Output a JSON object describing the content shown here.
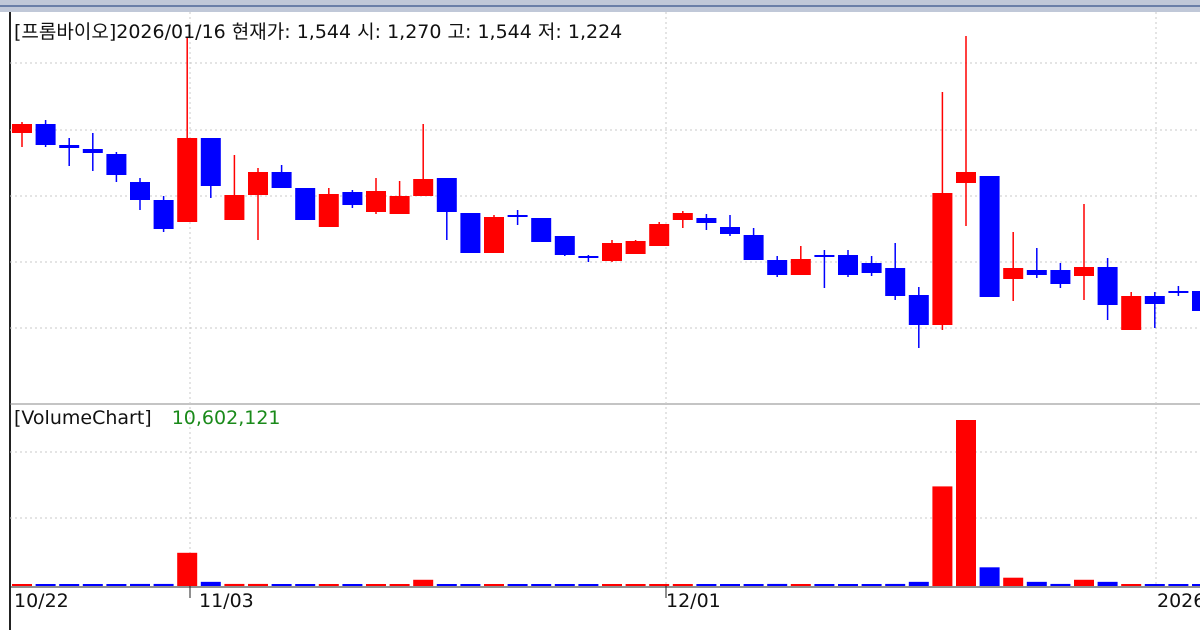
{
  "price_header": {
    "stock_name": "[프롬바이오]",
    "date": "2026/01/16",
    "current_label": "현재가:",
    "current": "1,544",
    "open_label": "시:",
    "open": "1,270",
    "high_label": "고:",
    "high": "1,544",
    "low_label": "저:",
    "low": "1,224"
  },
  "volume_header": {
    "label": "[VolumeChart]",
    "value": "10,602,121"
  },
  "colors": {
    "up": "#ff0000",
    "down": "#0000ff",
    "grid": "#c8c8c8",
    "axis": "#222222",
    "volume_value": "#1a8a1a"
  },
  "chart_data": [
    {
      "type": "candlestick",
      "x_tick_labels": [
        "10/22",
        "11/03",
        "12/01",
        "2026"
      ],
      "y_axis_labels_visible": false,
      "ylim": [
        38,
        412
      ],
      "grid": true,
      "candles": [
        {
          "o": 133,
          "c": 124,
          "h": 122,
          "l": 147,
          "dir": "up"
        },
        {
          "o": 124,
          "c": 145,
          "h": 120,
          "l": 147,
          "dir": "down"
        },
        {
          "o": 145,
          "c": 148,
          "h": 138,
          "l": 166,
          "dir": "down"
        },
        {
          "o": 149,
          "c": 153,
          "h": 133,
          "l": 171,
          "dir": "down"
        },
        {
          "o": 154,
          "c": 175,
          "h": 152,
          "l": 182,
          "dir": "down"
        },
        {
          "o": 182,
          "c": 200,
          "h": 178,
          "l": 210,
          "dir": "down"
        },
        {
          "o": 200,
          "c": 229,
          "h": 196,
          "l": 232,
          "dir": "down"
        },
        {
          "o": 222,
          "c": 138,
          "h": 38,
          "l": 222,
          "dir": "up"
        },
        {
          "o": 138,
          "c": 186,
          "h": 138,
          "l": 198,
          "dir": "down"
        },
        {
          "o": 220,
          "c": 195,
          "h": 155,
          "l": 220,
          "dir": "up"
        },
        {
          "o": 195,
          "c": 172,
          "h": 168,
          "l": 240,
          "dir": "up"
        },
        {
          "o": 172,
          "c": 188,
          "h": 165,
          "l": 188,
          "dir": "down"
        },
        {
          "o": 188,
          "c": 220,
          "h": 188,
          "l": 220,
          "dir": "down"
        },
        {
          "o": 227,
          "c": 194,
          "h": 188,
          "l": 227,
          "dir": "up"
        },
        {
          "o": 192,
          "c": 205,
          "h": 190,
          "l": 208,
          "dir": "down"
        },
        {
          "o": 212,
          "c": 191,
          "h": 178,
          "l": 214,
          "dir": "up"
        },
        {
          "o": 214,
          "c": 196,
          "h": 181,
          "l": 214,
          "dir": "up"
        },
        {
          "o": 196,
          "c": 179,
          "h": 124,
          "l": 196,
          "dir": "up"
        },
        {
          "o": 178,
          "c": 212,
          "h": 178,
          "l": 240,
          "dir": "down"
        },
        {
          "o": 213,
          "c": 253,
          "h": 213,
          "l": 253,
          "dir": "down"
        },
        {
          "o": 253,
          "c": 217,
          "h": 215,
          "l": 253,
          "dir": "up"
        },
        {
          "o": 215,
          "c": 217,
          "h": 210,
          "l": 225,
          "dir": "down"
        },
        {
          "o": 218,
          "c": 242,
          "h": 218,
          "l": 242,
          "dir": "down"
        },
        {
          "o": 236,
          "c": 255,
          "h": 236,
          "l": 256,
          "dir": "down"
        },
        {
          "o": 256,
          "c": 258,
          "h": 255,
          "l": 262,
          "dir": "down"
        },
        {
          "o": 261,
          "c": 243,
          "h": 240,
          "l": 262,
          "dir": "up"
        },
        {
          "o": 254,
          "c": 241,
          "h": 240,
          "l": 254,
          "dir": "up"
        },
        {
          "o": 246,
          "c": 224,
          "h": 222,
          "l": 246,
          "dir": "up"
        },
        {
          "o": 220,
          "c": 213,
          "h": 211,
          "l": 228,
          "dir": "up"
        },
        {
          "o": 218,
          "c": 223,
          "h": 214,
          "l": 230,
          "dir": "down"
        },
        {
          "o": 227,
          "c": 234,
          "h": 215,
          "l": 236,
          "dir": "down"
        },
        {
          "o": 235,
          "c": 260,
          "h": 228,
          "l": 260,
          "dir": "down"
        },
        {
          "o": 260,
          "c": 275,
          "h": 256,
          "l": 277,
          "dir": "down"
        },
        {
          "o": 275,
          "c": 259,
          "h": 246,
          "l": 275,
          "dir": "up"
        },
        {
          "o": 255,
          "c": 257,
          "h": 250,
          "l": 288,
          "dir": "down"
        },
        {
          "o": 255,
          "c": 275,
          "h": 250,
          "l": 277,
          "dir": "down"
        },
        {
          "o": 263,
          "c": 273,
          "h": 256,
          "l": 276,
          "dir": "down"
        },
        {
          "o": 268,
          "c": 296,
          "h": 243,
          "l": 300,
          "dir": "down"
        },
        {
          "o": 295,
          "c": 325,
          "h": 287,
          "l": 348,
          "dir": "down"
        },
        {
          "o": 325,
          "c": 193,
          "h": 92,
          "l": 330,
          "dir": "up"
        },
        {
          "o": 183,
          "c": 172,
          "h": 36,
          "l": 226,
          "dir": "up"
        },
        {
          "o": 176,
          "c": 297,
          "h": 176,
          "l": 297,
          "dir": "down"
        },
        {
          "o": 279,
          "c": 268,
          "h": 232,
          "l": 301,
          "dir": "up"
        },
        {
          "o": 270,
          "c": 275,
          "h": 248,
          "l": 278,
          "dir": "down"
        },
        {
          "o": 270,
          "c": 284,
          "h": 263,
          "l": 288,
          "dir": "down"
        },
        {
          "o": 276,
          "c": 267,
          "h": 204,
          "l": 300,
          "dir": "up"
        },
        {
          "o": 267,
          "c": 305,
          "h": 258,
          "l": 320,
          "dir": "down"
        },
        {
          "o": 330,
          "c": 296,
          "h": 292,
          "l": 326,
          "dir": "up"
        },
        {
          "o": 296,
          "c": 304,
          "h": 292,
          "l": 328,
          "dir": "down"
        },
        {
          "o": 291,
          "c": 292,
          "h": 286,
          "l": 296,
          "dir": "down"
        },
        {
          "o": 291,
          "c": 311,
          "h": 287,
          "l": 315,
          "dir": "down"
        }
      ]
    },
    {
      "type": "bar",
      "title": "[VolumeChart]",
      "y_axis_labels_visible": false,
      "ylim": [
        0,
        80
      ],
      "grid": true,
      "values": [
        0.4,
        0.4,
        0.4,
        0.4,
        0.4,
        1,
        1,
        16,
        2,
        1,
        1,
        0.4,
        0.4,
        0.4,
        0.4,
        0.4,
        0.4,
        3,
        0.4,
        0.4,
        0.4,
        0.4,
        0.4,
        0.4,
        0.4,
        0.4,
        0.4,
        0.4,
        0.4,
        0.4,
        0.4,
        0.4,
        1,
        0.4,
        0.4,
        0.4,
        0.4,
        1,
        2,
        48,
        80,
        9,
        4,
        2,
        1,
        3,
        2,
        0.4,
        0.4,
        0.4,
        0.4
      ],
      "directions": [
        "up",
        "down",
        "down",
        "down",
        "down",
        "down",
        "down",
        "up",
        "down",
        "up",
        "up",
        "down",
        "down",
        "up",
        "down",
        "up",
        "up",
        "up",
        "down",
        "down",
        "up",
        "down",
        "down",
        "down",
        "down",
        "up",
        "up",
        "up",
        "up",
        "down",
        "down",
        "down",
        "down",
        "up",
        "down",
        "down",
        "down",
        "down",
        "down",
        "up",
        "up",
        "down",
        "up",
        "down",
        "down",
        "up",
        "down",
        "up",
        "down",
        "down",
        "down"
      ]
    }
  ]
}
